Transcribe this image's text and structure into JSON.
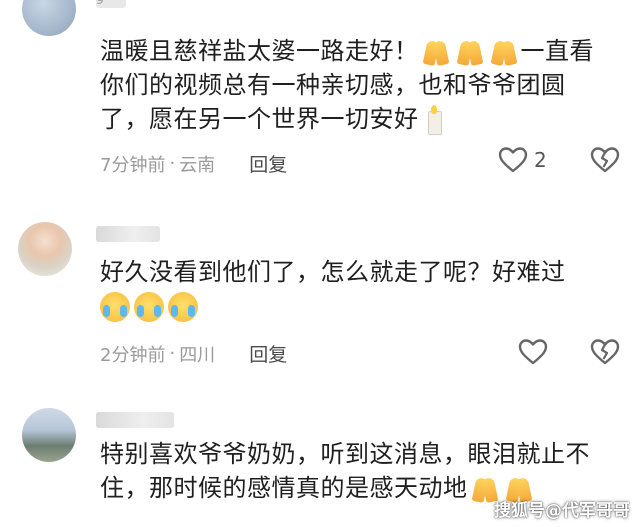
{
  "comments": [
    {
      "text_a": "温暖且慈祥盐太婆一路走好！",
      "text_b": "一直看你们的视频总有一种亲切感，也和爷爷团圆了，愿在另一个世界一切安好",
      "time": "7分钟前",
      "location": "云南",
      "reply": "回复",
      "likes": "2",
      "emoji": [
        "pray-icon",
        "pray-icon",
        "pray-icon",
        "candle-icon"
      ]
    },
    {
      "text_a": "好久没看到他们了，怎么就走了呢？好难过",
      "time": "2分钟前",
      "location": "四川",
      "reply": "回复",
      "emoji": [
        "crying-face-icon",
        "crying-face-icon",
        "crying-face-icon"
      ]
    },
    {
      "text_a": "特别喜欢爷爷奶奶，听到这消息，眼泪就止不住，那时候的感情真的是感天动地",
      "emoji": [
        "pray-icon",
        "pray-icon"
      ]
    }
  ],
  "partial_username": "9",
  "separator": "·",
  "watermark": "搜狐号@代军哥哥",
  "colors": {
    "meta": "#9a9a9a",
    "text": "#1f1f1f",
    "reply": "#4a4a4a"
  }
}
